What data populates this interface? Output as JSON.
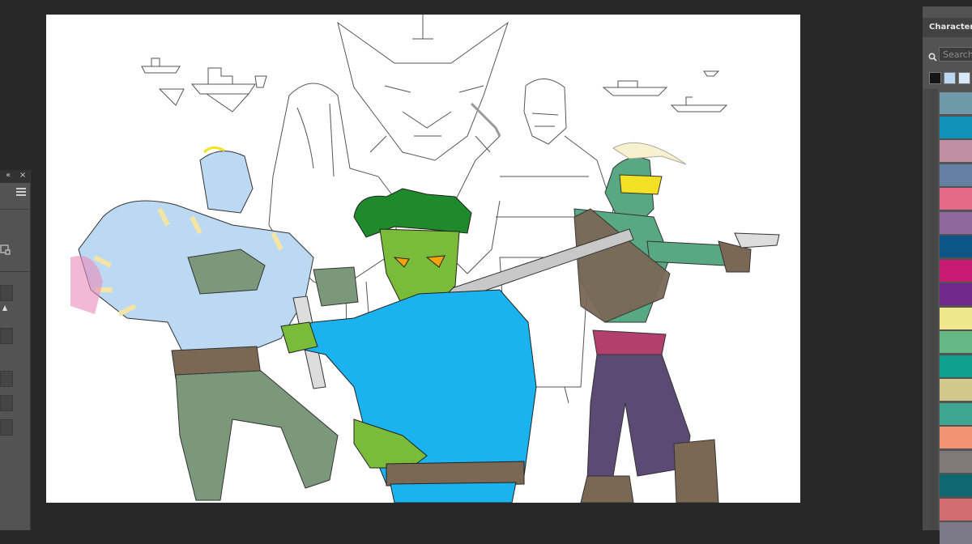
{
  "right_panel": {
    "title": "Character",
    "search_placeholder": "Search",
    "recent_swatches": [
      "#151515",
      "#bcd9f4",
      "#d7e9f8"
    ],
    "swatches": [
      "#6f98a8",
      "#0f92b8",
      "#bf8ea2",
      "#6481a3",
      "#e46b87",
      "#8e6a9c",
      "#0f5688",
      "#c81c73",
      "#70298c",
      "#f0e68c",
      "#63b884",
      "#0e9f90",
      "#d3c88c",
      "#3ea590",
      "#f29372",
      "#7f7a79",
      "#0f6871",
      "#d46d73",
      "#7c7a87"
    ]
  },
  "left_panel": {
    "collapse_icon": "«",
    "close_icon": "×"
  },
  "canvas": {
    "background": "#ffffff",
    "colors": {
      "blue_hero": "#1ab3ef",
      "green_skin": "#7bbb3a",
      "broccoli_hair": "#1f8a2b",
      "teal_skin": "#58a884",
      "purple_pants": "#5b4a73",
      "magenta_belt": "#b2406d",
      "brown_leather": "#7a6855",
      "goggles": "#f3e123",
      "hulk_body": "#bcd9f4",
      "hulk_stripes": "#f4e5a5",
      "hulk_pants": "#7c987a",
      "sword_blade": "#c8c8c8"
    }
  }
}
